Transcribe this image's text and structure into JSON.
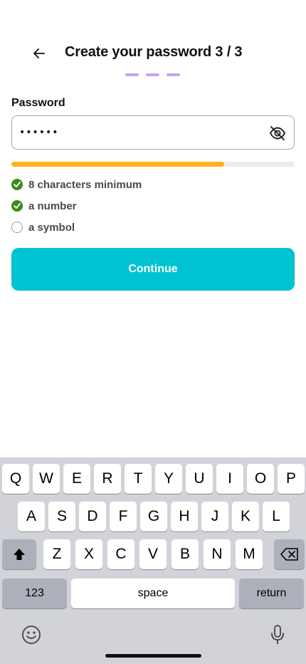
{
  "header": {
    "title": "Create your password 3 / 3",
    "back_icon": "arrow-left-icon"
  },
  "progress_steps": {
    "total": 3,
    "color": "#c9a4ee"
  },
  "form": {
    "password_label": "Password",
    "password_value": "••••••",
    "visibility_icon": "eye-off-icon",
    "strength_fraction": 0.75,
    "strength_color": "#fbb41d",
    "requirements": [
      {
        "label": "8 characters minimum",
        "met": true
      },
      {
        "label": "a number",
        "met": true
      },
      {
        "label": "a symbol",
        "met": false
      }
    ],
    "continue_label": "Continue",
    "accent_color": "#00c3d1"
  },
  "keyboard": {
    "row1": [
      "Q",
      "W",
      "E",
      "R",
      "T",
      "Y",
      "U",
      "I",
      "O",
      "P"
    ],
    "row2": [
      "A",
      "S",
      "D",
      "F",
      "G",
      "H",
      "J",
      "K",
      "L"
    ],
    "row3": [
      "Z",
      "X",
      "C",
      "V",
      "B",
      "N",
      "M"
    ],
    "numbers_label": "123",
    "space_label": "space",
    "return_label": "return",
    "shift_icon": "shift-icon",
    "delete_icon": "backspace-icon",
    "emoji_icon": "emoji-icon",
    "mic_icon": "microphone-icon"
  }
}
